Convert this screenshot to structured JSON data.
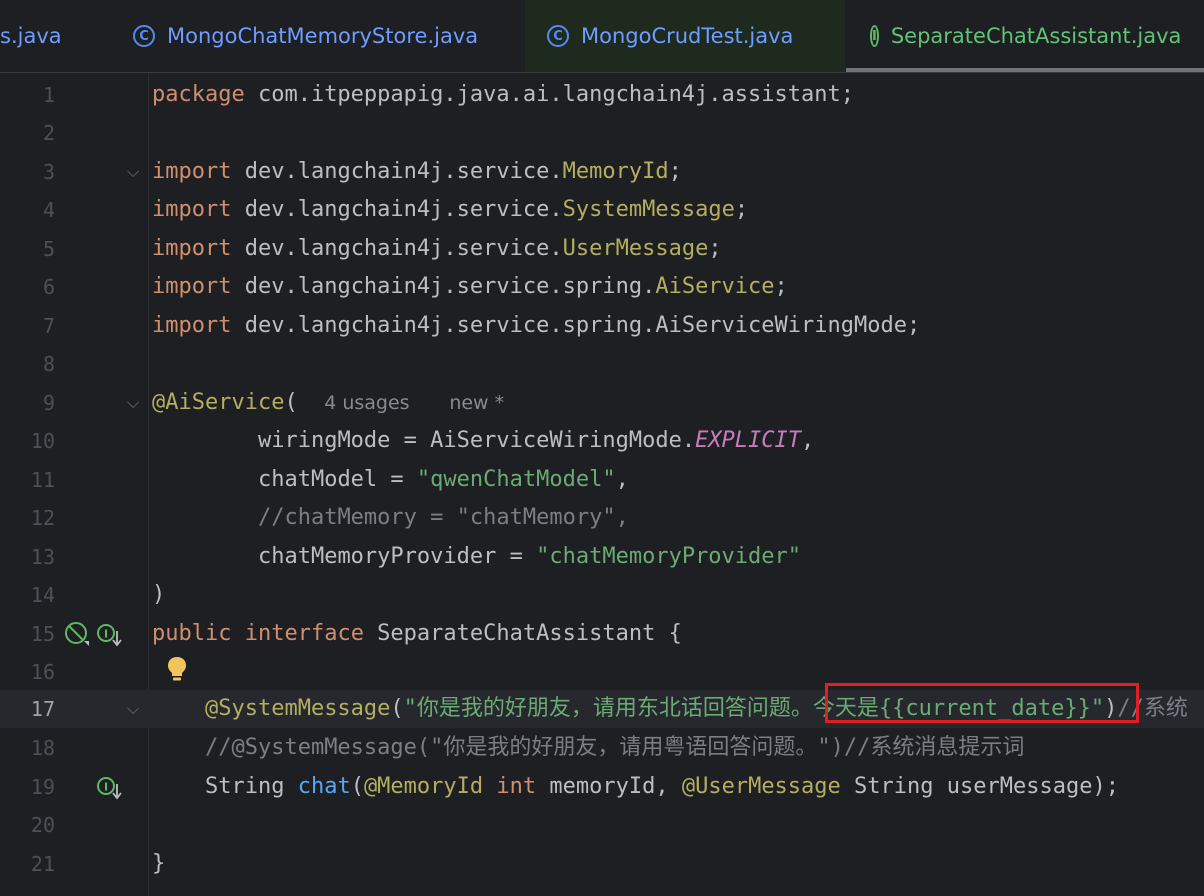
{
  "tabs": [
    {
      "label": "s.java",
      "kind": "partial"
    },
    {
      "label": "MongoChatMemoryStore.java",
      "icon": "class-icon",
      "icon_glyph": "C"
    },
    {
      "label": "MongoCrudTest.java",
      "icon": "class-icon",
      "icon_glyph": "C"
    },
    {
      "label": "SeparateChatAssistant.java",
      "icon": "interface-icon",
      "icon_glyph": "I",
      "active": true
    }
  ],
  "tab_close_glyph": "×",
  "editor": {
    "line_numbers": [
      "1",
      "2",
      "3",
      "4",
      "5",
      "6",
      "7",
      "8",
      "9",
      "10",
      "11",
      "12",
      "13",
      "14",
      "15",
      "16",
      "17",
      "18",
      "19",
      "20",
      "21"
    ],
    "current_line": "17",
    "inlay_hints": {
      "usages": "4 usages",
      "author": "new *"
    },
    "lines": {
      "l1": {
        "kw": "package",
        "rest": " com.itpeppapig.java.ai.langchain4j.assistant;"
      },
      "l3": {
        "kw": "import",
        "pkg": " dev.langchain4j.service.",
        "cls": "MemoryId",
        "end": ";"
      },
      "l4": {
        "kw": "import",
        "pkg": " dev.langchain4j.service.",
        "cls": "SystemMessage",
        "end": ";"
      },
      "l5": {
        "kw": "import",
        "pkg": " dev.langchain4j.service.",
        "cls": "UserMessage",
        "end": ";"
      },
      "l6": {
        "kw": "import",
        "pkg": " dev.langchain4j.service.spring.",
        "cls": "AiService",
        "end": ";"
      },
      "l7": {
        "kw": "import",
        "pkg": " dev.langchain4j.service.spring.AiServiceWiringMode;"
      },
      "l9": {
        "ann": "@AiService",
        "paren": "("
      },
      "l10": {
        "indent": "        ",
        "name": "wiringMode = AiServiceWiringMode.",
        "const": "EXPLICIT",
        "end": ","
      },
      "l11": {
        "indent": "        ",
        "name": "chatModel = ",
        "str": "\"qwenChatModel\"",
        "end": ","
      },
      "l12": {
        "indent": "        ",
        "cmt": "//chatMemory = \"chatMemory\","
      },
      "l13": {
        "indent": "        ",
        "name": "chatMemoryProvider = ",
        "str": "\"chatMemoryProvider\""
      },
      "l14": {
        "text": ")"
      },
      "l15": {
        "kw1": "public",
        "kw2": " interface",
        "rest": " SeparateChatAssistant {"
      },
      "l17": {
        "indent": "    ",
        "ann": "@SystemMessage",
        "open": "(",
        "str1": "\"你是我的好朋友，请用东北话回答问题。",
        "str2": "今天是{{current_date}}\"",
        "close": ")",
        "cmt": "//系统"
      },
      "l18": {
        "indent": "    ",
        "cmt": "//@SystemMessage(\"你是我的好朋友，请用粤语回答问题。\")//系统消息提示词"
      },
      "l19": {
        "indent": "    ",
        "type": "String ",
        "fn": "chat",
        "open": "(",
        "ann1": "@MemoryId",
        "kw": " int",
        "mid": " memoryId, ",
        "ann2": "@UserMessage",
        "rest": " String userMessage);"
      },
      "l21": {
        "text": "}"
      }
    }
  },
  "colors": {
    "keyword": "#cf8e6d",
    "annotation": "#b3ae60",
    "string": "#6aab73",
    "comment": "#7a7e85",
    "constant": "#c77dbb",
    "function": "#56a8f5",
    "highlight_box": "#e01e23"
  },
  "gutter_icons": {
    "line15": [
      "no-entry-icon",
      "implemented-interface-icon"
    ],
    "line16": [
      "lightbulb-icon"
    ],
    "line19": [
      "implemented-method-icon"
    ]
  }
}
